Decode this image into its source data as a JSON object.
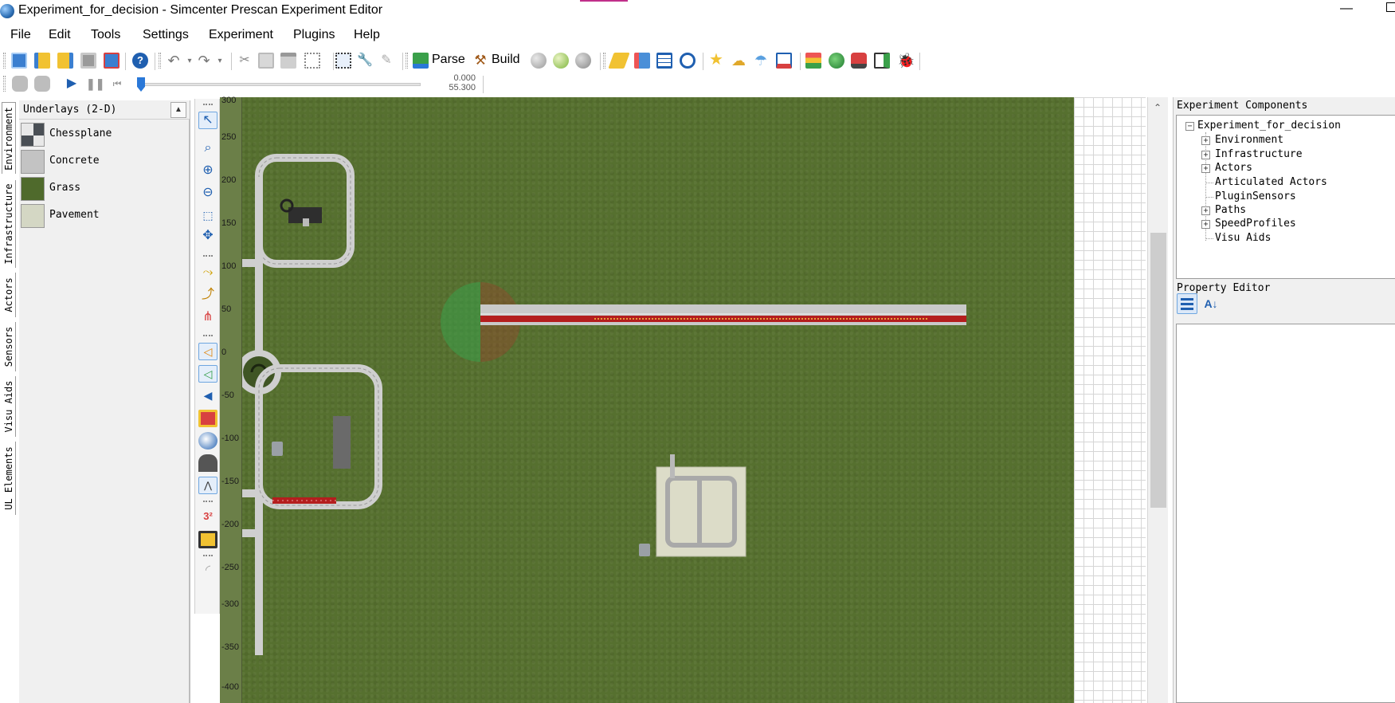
{
  "window": {
    "title": "Experiment_for_decision - Simcenter Prescan Experiment Editor",
    "minimize_glyph": "—"
  },
  "menu": [
    "File",
    "Edit",
    "Tools",
    "Settings",
    "Experiment",
    "Plugins",
    "Help"
  ],
  "toolbar": {
    "parse_label": "Parse",
    "build_label": "Build",
    "icons": [
      "new-experiment-icon",
      "open-icon",
      "open-recent-icon",
      "save-icon",
      "save-as-icon",
      "help-icon",
      "undo-icon",
      "redo-icon",
      "cut-icon",
      "copy-icon",
      "paste-icon",
      "select-all-icon",
      "fit-view-icon",
      "tools-icon",
      "pencil-icon",
      "parse-icon",
      "build-icon",
      "sphere-gray-icon",
      "sphere-green-icon",
      "sphere-dark-icon",
      "measure-icon",
      "edit-path-icon",
      "table-icon",
      "dashboard-icon",
      "star-icon",
      "weather-cloud-icon",
      "weather-rain-icon",
      "chart-icon",
      "layers-icon",
      "globe-icon",
      "vehicle-icon",
      "export-icon",
      "bug-icon"
    ]
  },
  "playback": {
    "time_start": "0.000",
    "time_end": "55.300",
    "slider_position": 0.0
  },
  "side_tabs": [
    "Environment",
    "Infrastructure",
    "Actors",
    "Sensors",
    "Visu Aids",
    "UL Elements"
  ],
  "underlays": {
    "title": "Underlays (2-D)",
    "collapse_glyph": "▲",
    "items": [
      {
        "label": "Chessplane",
        "swatch": "chess"
      },
      {
        "label": "Concrete",
        "swatch": "#c3c3c3"
      },
      {
        "label": "Grass",
        "swatch": "#4f6a2c"
      },
      {
        "label": "Pavement",
        "swatch": "#d4d7c4"
      }
    ]
  },
  "ruler": {
    "ticks": [
      "300",
      "250",
      "200",
      "150",
      "100",
      "50",
      "0",
      "-50",
      "-100",
      "-150",
      "-200",
      "-250",
      "-300",
      "-350",
      "-400"
    ]
  },
  "experiment_components": {
    "title": "Experiment Components",
    "root": "Experiment_for_decision",
    "children": [
      {
        "label": "Environment",
        "expandable": true
      },
      {
        "label": "Infrastructure",
        "expandable": true
      },
      {
        "label": "Actors",
        "expandable": true
      },
      {
        "label": "Articulated Actors",
        "expandable": false
      },
      {
        "label": "PluginSensors",
        "expandable": false
      },
      {
        "label": "Paths",
        "expandable": true
      },
      {
        "label": "SpeedProfiles",
        "expandable": true
      },
      {
        "label": "Visu Aids",
        "expandable": false
      }
    ]
  },
  "property_editor": {
    "title": "Property Editor",
    "sort_glyph": "A↓"
  },
  "colors": {
    "grass": "#56702f",
    "road": "#c9c9c9",
    "path_red": "#b41e1e",
    "accent_blue": "#2a78d8"
  }
}
